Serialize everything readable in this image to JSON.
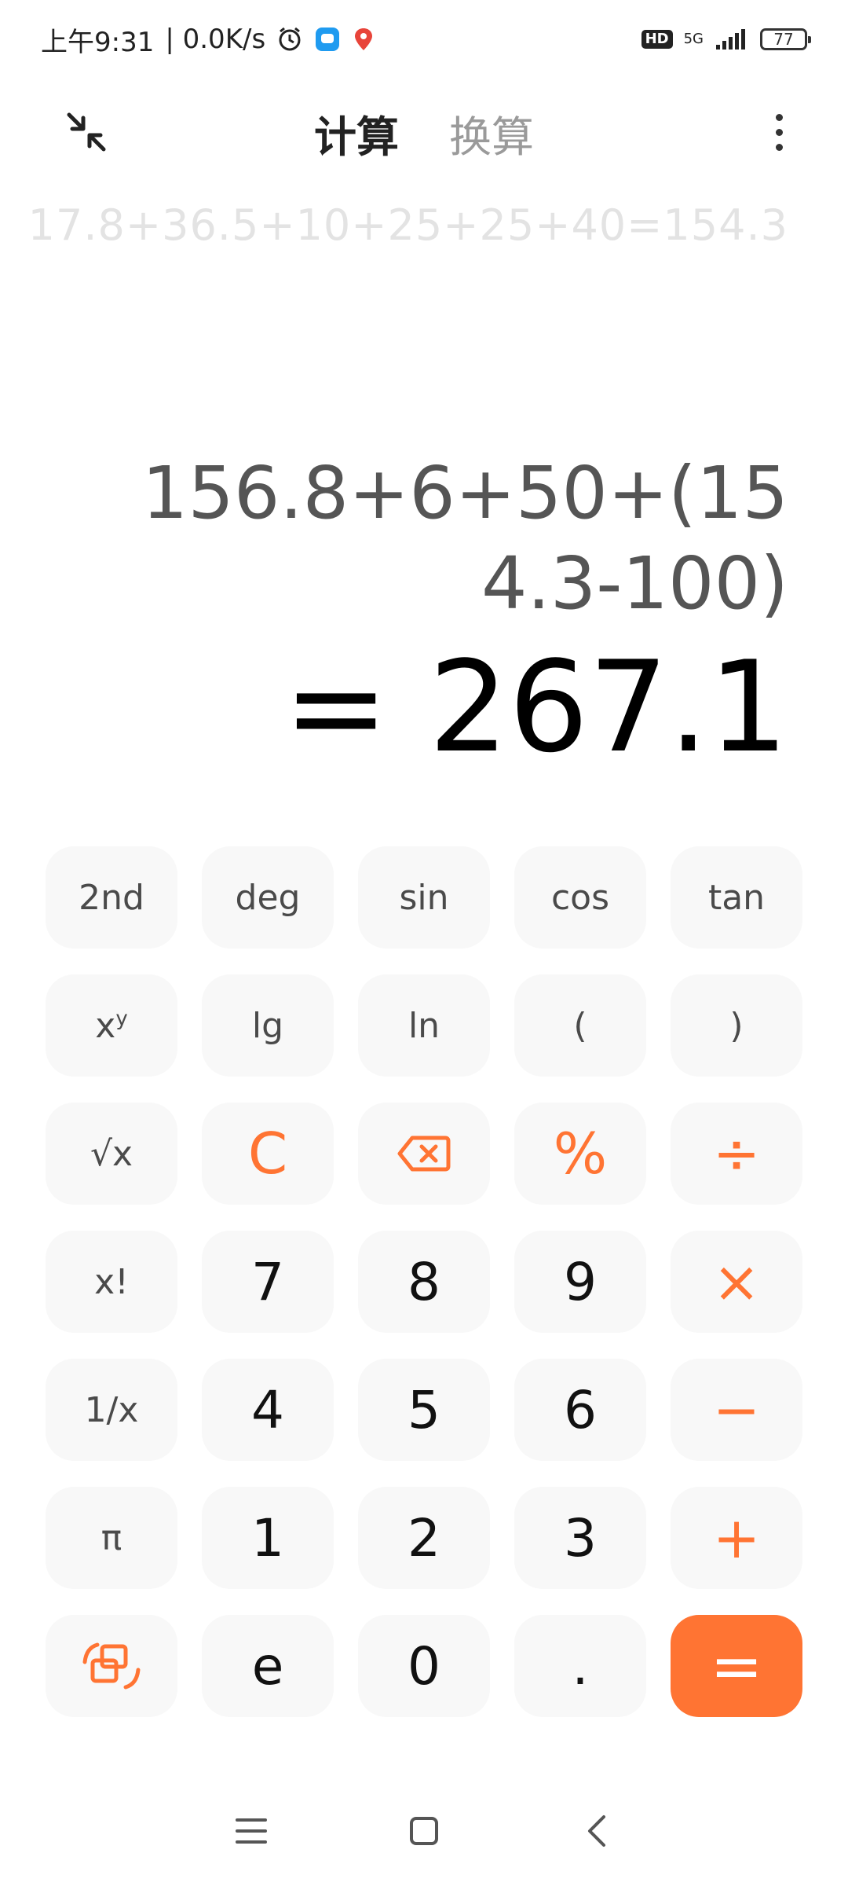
{
  "status_bar": {
    "time": "上午9:31",
    "speed": "| 0.0K/s",
    "hd": "HD",
    "network": "5G",
    "battery": "77"
  },
  "header": {
    "tabs": [
      {
        "label": "计算",
        "active": true
      },
      {
        "label": "换算",
        "active": false
      }
    ]
  },
  "display": {
    "history": "17.8+36.5+10+25+25+40=154.3",
    "expression": "156.8+6+50+(154.3-100)",
    "result": "= 267.1"
  },
  "keypad": {
    "rows": [
      [
        "2nd",
        "deg",
        "sin",
        "cos",
        "tan"
      ],
      [
        "x^y",
        "lg",
        "ln",
        "(",
        ")"
      ],
      [
        "√x",
        "C",
        "backspace",
        "%",
        "÷"
      ],
      [
        "x!",
        "7",
        "8",
        "9",
        "×"
      ],
      [
        "1/x",
        "4",
        "5",
        "6",
        "−"
      ],
      [
        "π",
        "1",
        "2",
        "3",
        "+"
      ],
      [
        "switch-mode",
        "e",
        "0",
        ".",
        "="
      ]
    ]
  },
  "colors": {
    "accent": "#ff7433",
    "key_bg": "#f8f8f8",
    "history_text": "#e3e3e3"
  }
}
